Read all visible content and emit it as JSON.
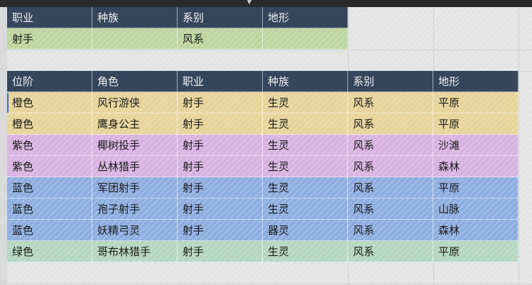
{
  "table1": {
    "headers": [
      "职业",
      "种族",
      "系别",
      "地形"
    ],
    "row": [
      "射手",
      "",
      "风系",
      ""
    ]
  },
  "table2": {
    "headers": [
      "位阶",
      "角色",
      "职业",
      "种族",
      "系别",
      "地形"
    ],
    "rows": [
      {
        "tier": "橙色",
        "role": "风行游侠",
        "job": "射手",
        "race": "生灵",
        "element": "风系",
        "terrain": "平原",
        "color": "#e6d49a"
      },
      {
        "tier": "橙色",
        "role": "鹰身公主",
        "job": "射手",
        "race": "生灵",
        "element": "风系",
        "terrain": "平原",
        "color": "#e6d49a"
      },
      {
        "tier": "紫色",
        "role": "椰树投手",
        "job": "射手",
        "race": "生灵",
        "element": "风系",
        "terrain": "沙滩",
        "color": "#d8b3e2"
      },
      {
        "tier": "紫色",
        "role": "丛林猎手",
        "job": "射手",
        "race": "生灵",
        "element": "风系",
        "terrain": "森林",
        "color": "#d8b3e2"
      },
      {
        "tier": "蓝色",
        "role": "军团射手",
        "job": "射手",
        "race": "生灵",
        "element": "风系",
        "terrain": "平原",
        "color": "#8eaee0"
      },
      {
        "tier": "蓝色",
        "role": "孢子射手",
        "job": "射手",
        "race": "生灵",
        "element": "风系",
        "terrain": "山脉",
        "color": "#8eaee0"
      },
      {
        "tier": "蓝色",
        "role": "妖精弓灵",
        "job": "射手",
        "race": "器灵",
        "element": "风系",
        "terrain": "森林",
        "color": "#8eaee0"
      },
      {
        "tier": "绿色",
        "role": "哥布林猎手",
        "job": "射手",
        "race": "生灵",
        "element": "风系",
        "terrain": "平原",
        "color": "#b4d7bf"
      }
    ]
  },
  "colors": {
    "header_bg": "#35465c",
    "orange": "#e6d49a",
    "purple": "#d8b3e2",
    "blue": "#8eaee0",
    "green": "#b4d7bf",
    "selected": "#bdd59f"
  }
}
